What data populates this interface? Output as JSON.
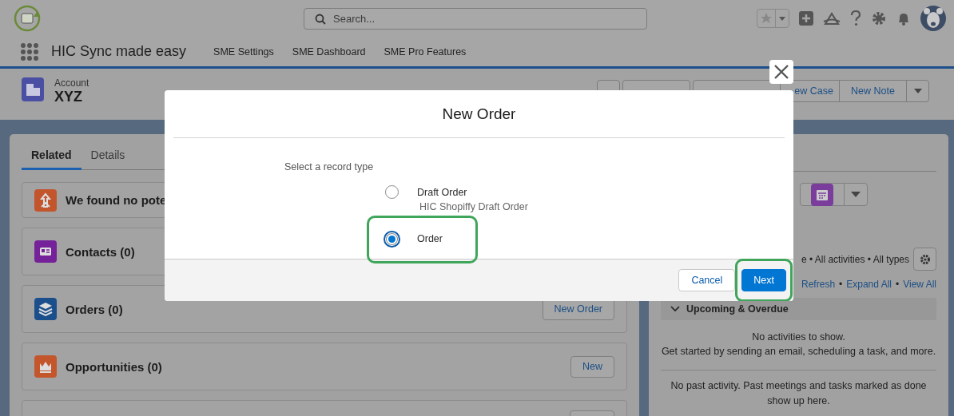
{
  "header": {
    "search": {
      "placeholder": "Search..."
    }
  },
  "app_nav": {
    "app_name": "HIC Sync made easy",
    "items": [
      {
        "label": "SME Settings"
      },
      {
        "label": "SME Dashboard"
      },
      {
        "label": "SME Pro Features"
      }
    ]
  },
  "record": {
    "object_label": "Account",
    "name": "XYZ",
    "actions": [
      {
        "label": "ew Case"
      },
      {
        "label": "New Note"
      }
    ]
  },
  "tabs": [
    {
      "label": "Related",
      "selected": true
    },
    {
      "label": "Details",
      "selected": false
    }
  ],
  "related_lists": [
    {
      "title": "We found no pote",
      "kind": "duplicates"
    },
    {
      "title": "Contacts (0)",
      "kind": "contacts"
    },
    {
      "title": "Orders (0)",
      "kind": "orders",
      "button": "New Order"
    },
    {
      "title": "Opportunities (0)",
      "kind": "opportunities",
      "button": "New"
    }
  ],
  "activity": {
    "filter": "e • All activities • All types",
    "separator": "•",
    "links": [
      "Refresh",
      "Expand All",
      "View All"
    ],
    "sections": [
      {
        "title": "Upcoming & Overdue",
        "expanded": true,
        "empty_text": "No activities to show.",
        "hint": "Get started by sending an email, scheduling a task, and more."
      }
    ],
    "past_text": "No past activity. Past meetings and tasks marked as done show up here."
  },
  "modal": {
    "title": "New Order",
    "prompt": "Select a record type",
    "options": [
      {
        "label": "Draft Order",
        "description": "HIC Shopiffy Draft Order",
        "selected": false,
        "highlighted": false
      },
      {
        "label": "Order",
        "selected": true,
        "highlighted": true
      }
    ],
    "buttons": [
      {
        "label": "Cancel",
        "kind": "neutral",
        "highlighted": false
      },
      {
        "label": "Next",
        "kind": "brand",
        "highlighted": true
      }
    ]
  }
}
